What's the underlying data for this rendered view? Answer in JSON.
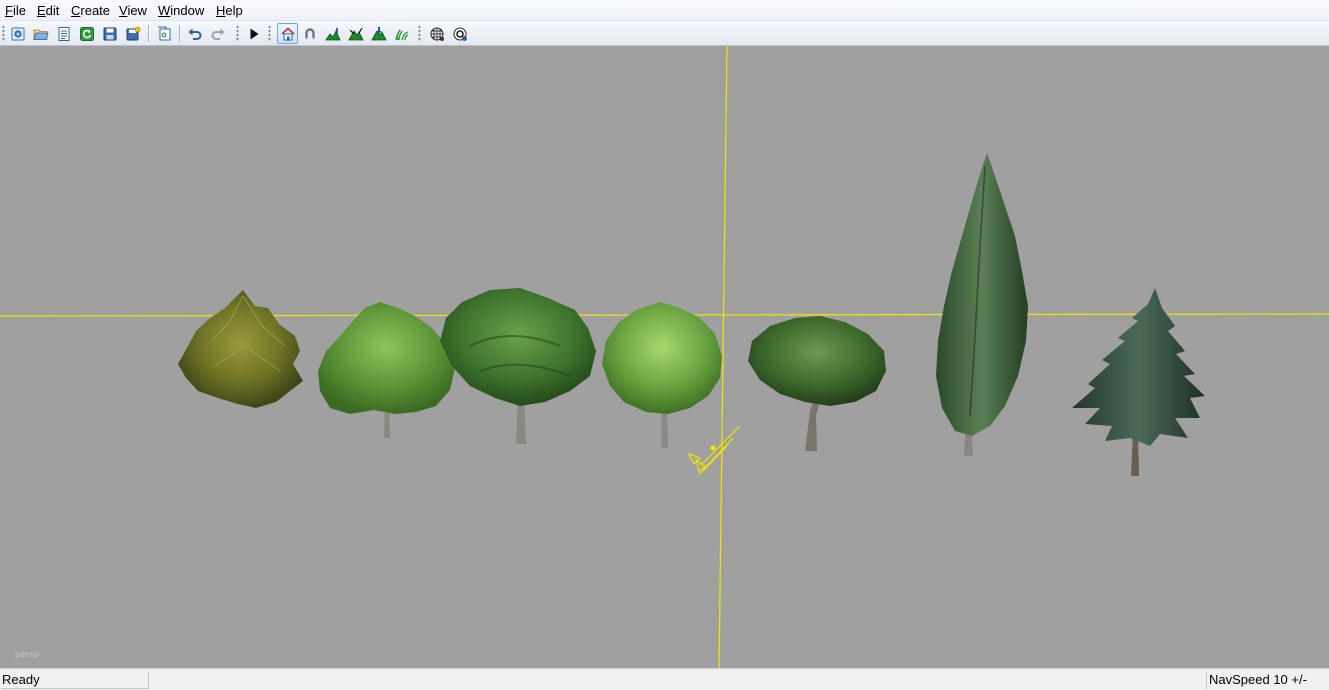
{
  "menu": [
    {
      "label": "File",
      "key": "F",
      "rest": "ile"
    },
    {
      "label": "Edit",
      "key": "E",
      "rest": "dit"
    },
    {
      "label": "Create",
      "key": "C",
      "rest": "reate"
    },
    {
      "label": "View",
      "key": "V",
      "rest": "iew"
    },
    {
      "label": "Window",
      "key": "W",
      "rest": "indow"
    },
    {
      "label": "Help",
      "key": "H",
      "rest": "elp"
    }
  ],
  "toolbar": {
    "icons": [
      "new-scene-icon",
      "open-icon",
      "document-icon",
      "refresh-icon",
      "save-icon",
      "save-all-icon",
      "import-icon",
      "undo-icon",
      "redo-icon",
      "play-icon",
      "home-icon",
      "magnet-icon",
      "terrain-icon",
      "mountain-icon",
      "mountain-select-icon",
      "grass-icon",
      "sphere-checker-icon",
      "sphere-settings-icon"
    ],
    "active": "home-icon"
  },
  "viewport": {
    "camera_label": "persp",
    "background": "#a0a0a0",
    "grid_color": "#f0e600",
    "trees": [
      {
        "name": "tree-spruce-olive"
      },
      {
        "name": "tree-broadleaf-light"
      },
      {
        "name": "tree-oak-dark"
      },
      {
        "name": "tree-round-bright"
      },
      {
        "name": "tree-broadleaf-dark"
      },
      {
        "name": "tree-cypress-tall"
      },
      {
        "name": "tree-fir"
      }
    ]
  },
  "status": {
    "text": "Ready",
    "navspeed": "NavSpeed 10 +/-"
  }
}
